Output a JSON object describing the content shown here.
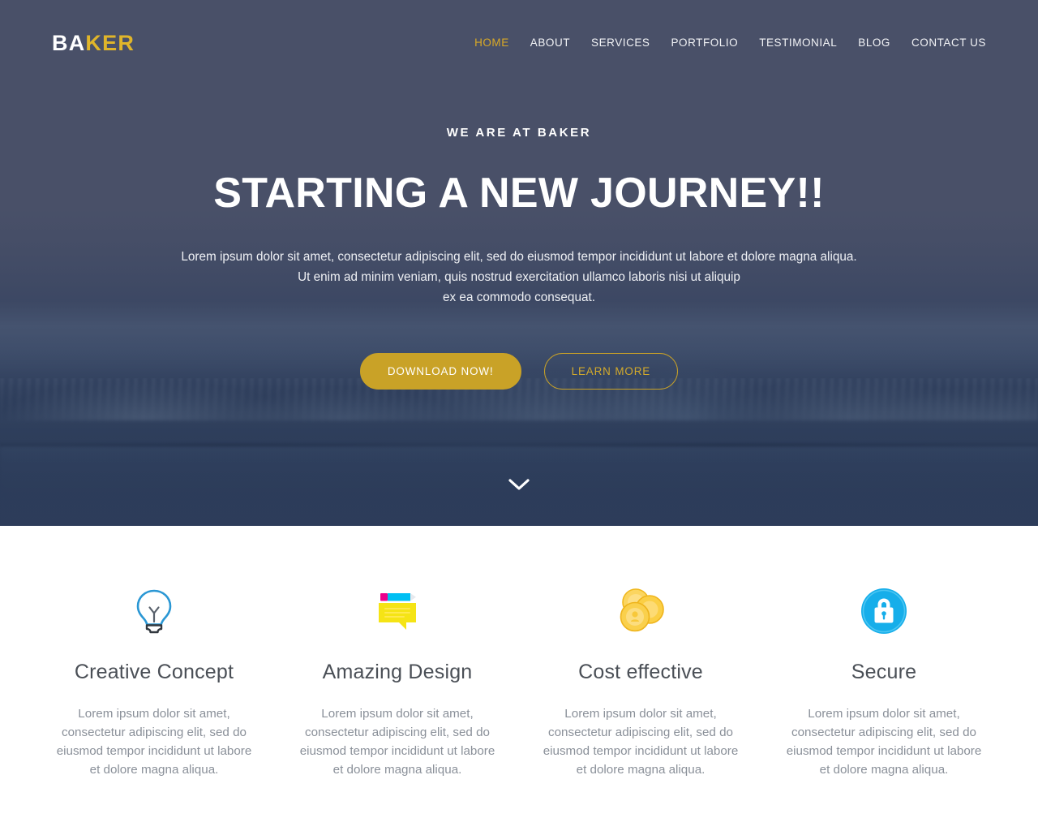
{
  "colors": {
    "hero_overlay": "#495068",
    "gold": "#c9a227",
    "gold_light": "#e0b52a",
    "nav_active": "#d9a926",
    "feature_title": "#4a4f56",
    "feature_text": "#8a9099",
    "icon_blue": "#1ba7e8",
    "icon_yellow": "#f5e415",
    "icon_cyan": "#00bff3",
    "icon_magenta": "#ec008c",
    "icon_coin_gold": "#f9cf4a",
    "white": "#ffffff"
  },
  "header": {
    "logo_part_white": "BA",
    "logo_part_gold": "KER",
    "nav": [
      {
        "label": "HOME",
        "active": true
      },
      {
        "label": "ABOUT",
        "active": false
      },
      {
        "label": "SERVICES",
        "active": false
      },
      {
        "label": "PORTFOLIO",
        "active": false
      },
      {
        "label": "TESTIMONIAL",
        "active": false
      },
      {
        "label": "BLOG",
        "active": false
      },
      {
        "label": "CONTACT US",
        "active": false
      }
    ]
  },
  "hero": {
    "eyebrow": "WE ARE AT BAKER",
    "title": "STARTING A NEW JOURNEY!!",
    "paragraph_line1": "Lorem ipsum dolor sit amet, consectetur adipiscing elit, sed do eiusmod tempor incididunt ut labore et dolore magna aliqua.",
    "paragraph_line2": "Ut enim ad minim veniam, quis nostrud exercitation ullamco laboris nisi ut aliquip",
    "paragraph_line3": "ex ea commodo consequat.",
    "primary_button": "DOWNLOAD NOW!",
    "secondary_button": "LEARN MORE",
    "scroll_icon": "chevron-down-icon",
    "background_description": "glacier iceberg landscape with water reflection"
  },
  "features": [
    {
      "icon": "lightbulb-icon",
      "title": "Creative Concept",
      "text": "Lorem ipsum dolor sit amet, consectetur adipiscing elit, sed do eiusmod tempor incididunt ut labore et dolore magna aliqua."
    },
    {
      "icon": "note-pencil-icon",
      "title": "Amazing Design",
      "text": "Lorem ipsum dolor sit amet, consectetur adipiscing elit, sed do eiusmod tempor incididunt ut labore et dolore magna aliqua."
    },
    {
      "icon": "coins-icon",
      "title": "Cost effective",
      "text": "Lorem ipsum dolor sit amet, consectetur adipiscing elit, sed do eiusmod tempor incididunt ut labore et dolore magna aliqua."
    },
    {
      "icon": "lock-circle-icon",
      "title": "Secure",
      "text": "Lorem ipsum dolor sit amet, consectetur adipiscing elit, sed do eiusmod tempor incididunt ut labore et dolore magna aliqua."
    }
  ]
}
